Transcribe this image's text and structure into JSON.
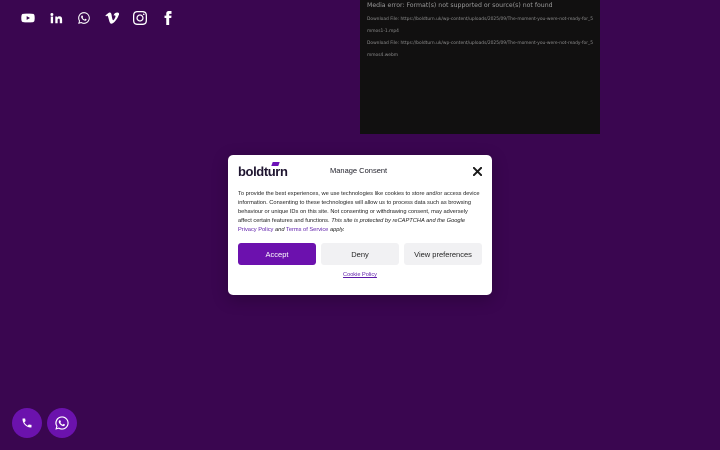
{
  "social": [
    {
      "icon": "youtube-icon"
    },
    {
      "icon": "linkedin-icon"
    },
    {
      "icon": "whatsapp-icon"
    },
    {
      "icon": "vimeo-icon"
    },
    {
      "icon": "instagram-icon"
    },
    {
      "icon": "facebook-icon"
    }
  ],
  "media": {
    "error": "Media error: Format(s) not supported or source(s) not found",
    "download_1": "Download File: https://boldturn.uk/wp-content/uploads/2025/09/The-moment-you-were-not-ready-for_5mmos1-1.mp4",
    "download_2": "Download File: https://boldturn.uk/wp-content/uploads/2025/09/The-moment-you-were-not-ready-for_5mmos4.webm"
  },
  "consent": {
    "logo": "boldturn",
    "title": "Manage Consent",
    "body_plain": "To provide the best experiences, we use technologies like cookies to store and/or access device information. Consenting to these technologies will allow us to process data such as browsing behaviour or unique IDs on this site. Not consenting or withdrawing consent, may adversely affect certain features and functions.",
    "body_italic_1": "This site is protected by reCAPTCHA and the Google",
    "privacy_link": "Privacy Policy",
    "body_italic_2": "and",
    "terms_link": "Terms of Service",
    "body_italic_3": "apply.",
    "accept_label": "Accept",
    "deny_label": "Deny",
    "prefs_label": "View preferences",
    "cookie_policy_label": "Cookie Policy"
  },
  "colors": {
    "background": "#3a0650",
    "accent": "#6c11ae"
  }
}
